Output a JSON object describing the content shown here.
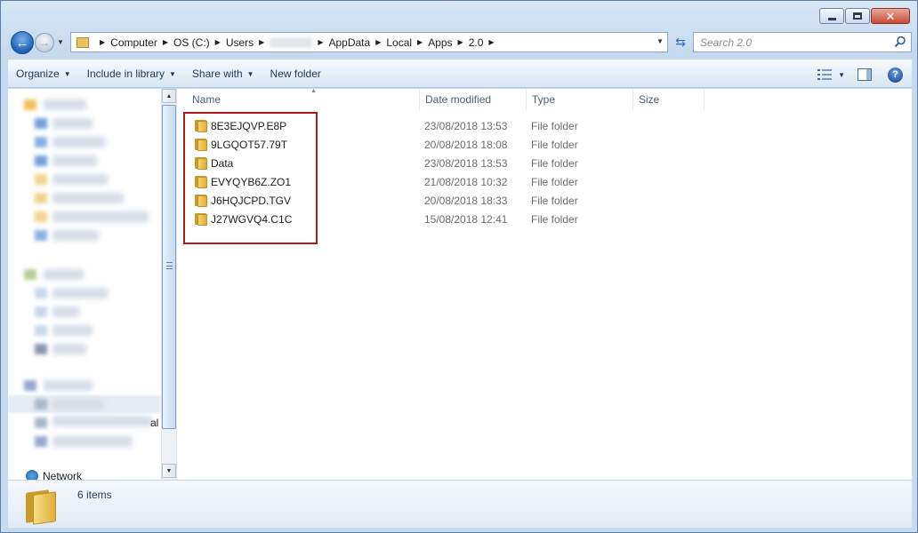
{
  "window": {
    "buttons": [
      "minimize",
      "maximize",
      "close"
    ]
  },
  "address_bar": {
    "crumbs": [
      "Computer",
      "OS (C:)",
      "Users",
      "",
      "AppData",
      "Local",
      "Apps",
      "2.0"
    ]
  },
  "search": {
    "placeholder": "Search 2.0"
  },
  "toolbar": {
    "organize": "Organize",
    "include_in_library": "Include in library",
    "share_with": "Share with",
    "new_folder": "New folder"
  },
  "nav_pane": {
    "partial_text": "al",
    "network_label": "Network"
  },
  "columns": {
    "name": "Name",
    "date_modified": "Date modified",
    "type": "Type",
    "size": "Size"
  },
  "files": [
    {
      "name": "8E3EJQVP.E8P",
      "date": "23/08/2018 13:53",
      "type": "File folder"
    },
    {
      "name": "9LGQOT57.79T",
      "date": "20/08/2018 18:08",
      "type": "File folder"
    },
    {
      "name": "Data",
      "date": "23/08/2018 13:53",
      "type": "File folder"
    },
    {
      "name": "EVYQYB6Z.ZO1",
      "date": "21/08/2018 10:32",
      "type": "File folder"
    },
    {
      "name": "J6HQJCPD.TGV",
      "date": "20/08/2018 18:33",
      "type": "File folder"
    },
    {
      "name": "J27WGVQ4.C1C",
      "date": "15/08/2018 12:41",
      "type": "File folder"
    }
  ],
  "status": {
    "item_count": "6 items"
  },
  "colors": {
    "highlight_box": "#b0181e",
    "toolbar_text": "#1e395b",
    "window_frame": "#c6d9ef"
  }
}
